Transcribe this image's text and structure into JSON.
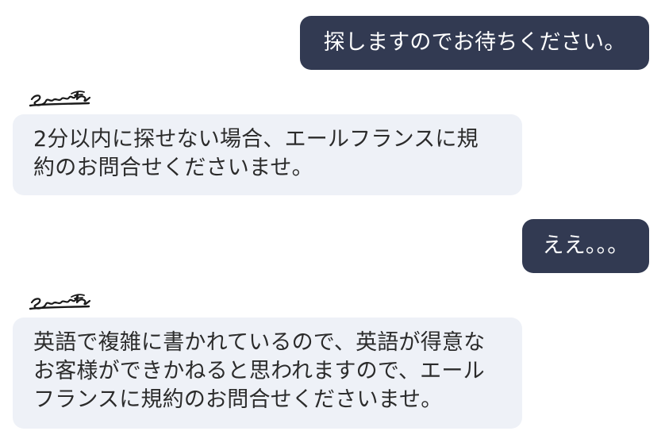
{
  "conversation": {
    "messages": [
      {
        "sender": "user",
        "lines": [
          "探しますのでお待ちください。"
        ]
      },
      {
        "sender": "agent",
        "lines": [
          "2分以内に探せない場合、エールフランスに規",
          "約のお問合せくださいませ。"
        ]
      },
      {
        "sender": "user",
        "lines": [
          "ええ。。。"
        ]
      },
      {
        "sender": "agent",
        "lines": [
          "英語で複雑に書かれているので、英語が得意な",
          "お客様ができかねると思われますので、エール",
          "フランスに規約のお問合せくださいませ。"
        ]
      }
    ]
  },
  "colors": {
    "outgoing_bubble": "#323a52",
    "incoming_bubble": "#eef1f7",
    "outgoing_text": "#ffffff",
    "incoming_text": "#2b2b2b"
  }
}
